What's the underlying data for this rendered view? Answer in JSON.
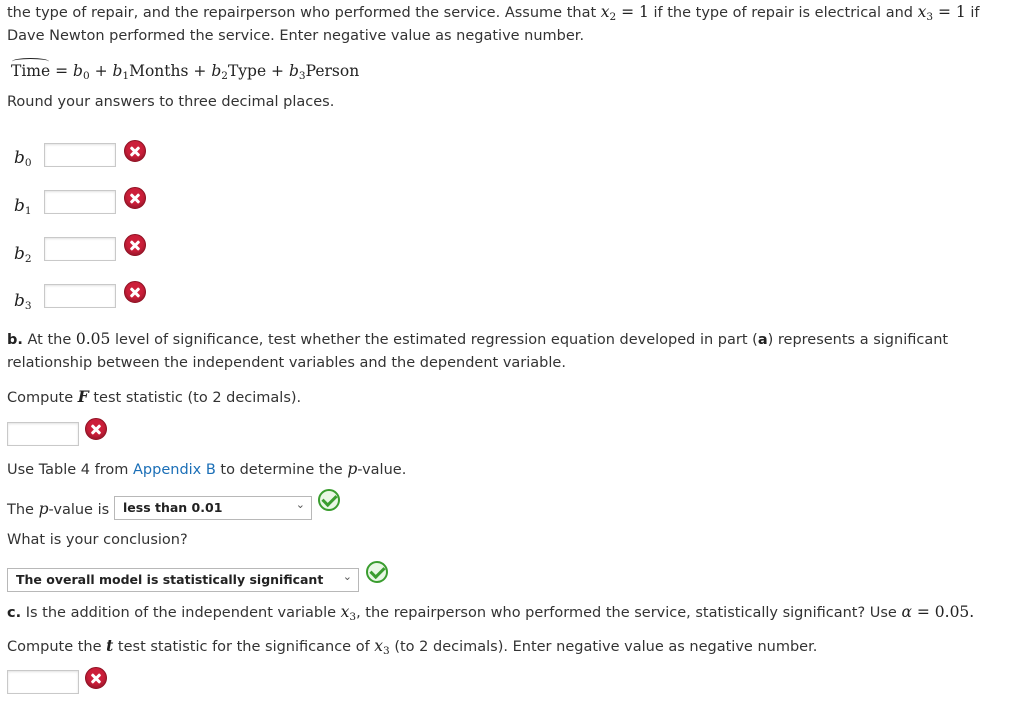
{
  "intro": {
    "line1_a": "the type of repair, and the repairperson who performed the service. Assume that ",
    "x2": "x",
    "x2_sub": "2",
    "eq1": " = 1",
    "line1_b": " if the type of repair is electrical and ",
    "x3": "x",
    "x3_sub": "3",
    "eq2": " = 1",
    "line1_c": " if",
    "line2": "Dave Newton performed the service. Enter negative value as negative number."
  },
  "equation": {
    "lhs": "Time",
    "rest_a": " = ",
    "b0": "b",
    "b0_sub": "0",
    "plus1": " + ",
    "b1": "b",
    "b1_sub": "1",
    "t1": "Months + ",
    "b2": "b",
    "b2_sub": "2",
    "t2": "Type + ",
    "b3": "b",
    "b3_sub": "3",
    "t3": "Person"
  },
  "round_note": "Round your answers to three decimal places.",
  "coefficients": [
    {
      "symbol": "b",
      "sub": "0"
    },
    {
      "symbol": "b",
      "sub": "1"
    },
    {
      "symbol": "b",
      "sub": "2"
    },
    {
      "symbol": "b",
      "sub": "3"
    }
  ],
  "part_b": {
    "label": "b.",
    "text_a": " At the ",
    "level": "0.05",
    "text_b": " level of significance, test whether the estimated regression equation developed in part (",
    "part_ref": "a",
    "text_c": ") represents a significant",
    "line2": "relationship between the independent variables and the dependent variable.",
    "compute_a": "Compute ",
    "F": "F",
    "compute_b": " test statistic (to 2 decimals).",
    "use_a": "Use Table 4 from ",
    "appendix_link": "Appendix B",
    "use_b": " to determine the ",
    "p": "p",
    "use_c": "-value.",
    "pvalue_a": "The ",
    "pvalue_b": "-value is",
    "pvalue_selected": "less than 0.01",
    "conclusion_q": "What is your conclusion?",
    "conclusion_selected": "The overall model is statistically significant"
  },
  "part_c": {
    "label": "c.",
    "text_a": " Is the addition of the independent variable ",
    "x": "x",
    "x_sub": "3",
    "text_b": ", the repairperson who performed the service, statistically significant? Use ",
    "alpha": "α",
    "alpha_val": " = 0.05.",
    "compute_a": "Compute the ",
    "t": "t",
    "compute_b": " test statistic for the significance of ",
    "x2": "x",
    "x2_sub": "3",
    "compute_c": " (to 2 decimals). Enter negative value as negative number."
  },
  "icons": {
    "incorrect": "incorrect-x-icon",
    "correct": "correct-check-icon",
    "dropdown": "chevron-down-icon"
  },
  "colors": {
    "incorrect": "#cc1f3a",
    "correct": "#3a9d2f",
    "link": "#1b6fb7"
  }
}
